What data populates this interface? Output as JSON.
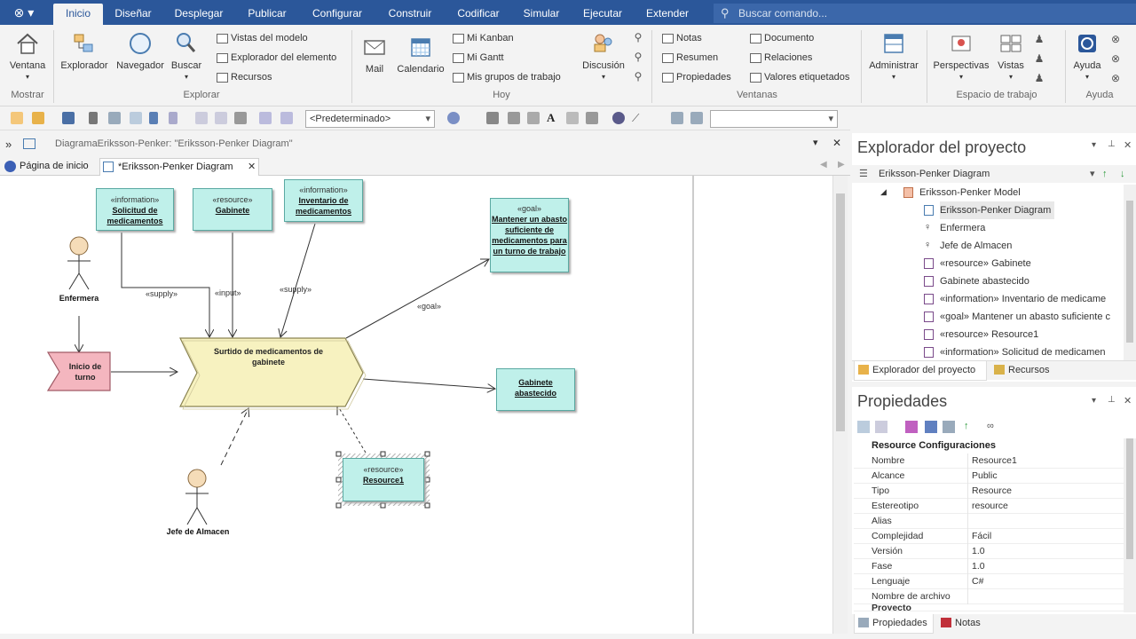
{
  "ribbon": {
    "tabs": [
      "Inicio",
      "Diseñar",
      "Desplegar",
      "Publicar",
      "Configurar",
      "Construir",
      "Codificar",
      "Simular",
      "Ejecutar",
      "Extender"
    ],
    "active_tab": "Inicio",
    "search_placeholder": "Buscar comando...",
    "buttons": {
      "ventana": "Ventana",
      "explorador": "Explorador",
      "navegador": "Navegador",
      "buscar": "Buscar",
      "mail": "Mail",
      "calendario": "Calendario",
      "discusion": "Discusión",
      "administrar": "Administrar",
      "perspectivas": "Perspectivas",
      "vistas": "Vistas",
      "ayuda": "Ayuda"
    },
    "small_items": {
      "vistas_modelo": "Vistas del modelo",
      "explorador_elemento": "Explorador del elemento",
      "recursos": "Recursos",
      "mi_kanban": "Mi Kanban",
      "mi_gantt": "Mi Gantt",
      "mis_grupos": "Mis grupos de trabajo",
      "notas": "Notas",
      "resumen": "Resumen",
      "propiedades": "Propiedades",
      "documento": "Documento",
      "relaciones": "Relaciones",
      "valores_etiquetados": "Valores etiquetados"
    },
    "groups": {
      "mostrar": "Mostrar",
      "explorar": "Explorar",
      "hoy": "Hoy",
      "ventanas": "Ventanas",
      "espacio": "Espacio de trabajo",
      "ayuda": "Ayuda"
    }
  },
  "toolbar": {
    "style_select": "<Predeterminado>"
  },
  "diagram": {
    "path": "DiagramaEriksson-Penker: \"Eriksson-Penker Diagram\"",
    "tabs": [
      "Página de inicio",
      "*Eriksson-Penker Diagram"
    ],
    "elements": {
      "solicitud": {
        "stereo": "«information»",
        "name": "Solicitud de medicamentos"
      },
      "gabinete": {
        "stereo": "«resource»",
        "name": "Gabinete"
      },
      "inventario": {
        "stereo": "«information»",
        "name": "Inventario de medicamentos"
      },
      "goal": {
        "stereo": "«goal»",
        "name": "Mantener un abasto suficiente de medicamentos para un turno de trabajo"
      },
      "process": {
        "name": "Surtido de medicamentos de gabinete"
      },
      "inicio": {
        "name": "Inicio de turno"
      },
      "abastecido": {
        "name": "Gabinete abastecido"
      },
      "resource1": {
        "stereo": "«resource»",
        "name": "Resource1"
      },
      "enfermera": {
        "name": "Enfermera"
      },
      "jefe": {
        "name": "Jefe de Almacen"
      }
    },
    "labels": {
      "supply1": "«supply»",
      "input": "«input»",
      "supply2": "«supply»",
      "goal": "«goal»"
    }
  },
  "project_explorer": {
    "title": "Explorador del proyecto",
    "header": "Eriksson-Penker Diagram",
    "items": [
      "Eriksson-Penker Model",
      "Eriksson-Penker Diagram",
      "Enfermera",
      "Jefe de Almacen",
      "«resource» Gabinete",
      "Gabinete abastecido",
      "«information» Inventario de medicame",
      "«goal» Mantener un abasto suficiente c",
      "«resource» Resource1",
      "«information» Solicitud de medicamen"
    ],
    "tabs": [
      "Explorador del proyecto",
      "Recursos"
    ]
  },
  "properties": {
    "title": "Propiedades",
    "section": "Resource Configuraciones",
    "rows": [
      {
        "k": "Nombre",
        "v": "Resource1"
      },
      {
        "k": "Alcance",
        "v": "Public"
      },
      {
        "k": "Tipo",
        "v": "Resource"
      },
      {
        "k": "Estereotipo",
        "v": "resource"
      },
      {
        "k": "Alias",
        "v": ""
      },
      {
        "k": "Complejidad",
        "v": "Fácil"
      },
      {
        "k": "Versión",
        "v": "1.0"
      },
      {
        "k": "Fase",
        "v": "1.0"
      },
      {
        "k": "Lenguaje",
        "v": "C#"
      },
      {
        "k": "Nombre de archivo",
        "v": ""
      },
      {
        "k": "Proyecto",
        "v": ""
      }
    ],
    "tabs": [
      "Propiedades",
      "Notas"
    ]
  },
  "colors": {
    "ribbon_blue": "#2b579a",
    "element_fill": "#bff0ea",
    "process_fill": "#f7f2c0",
    "event_fill": "#f4b6bf",
    "actor_fill": "#f5dcb8"
  }
}
